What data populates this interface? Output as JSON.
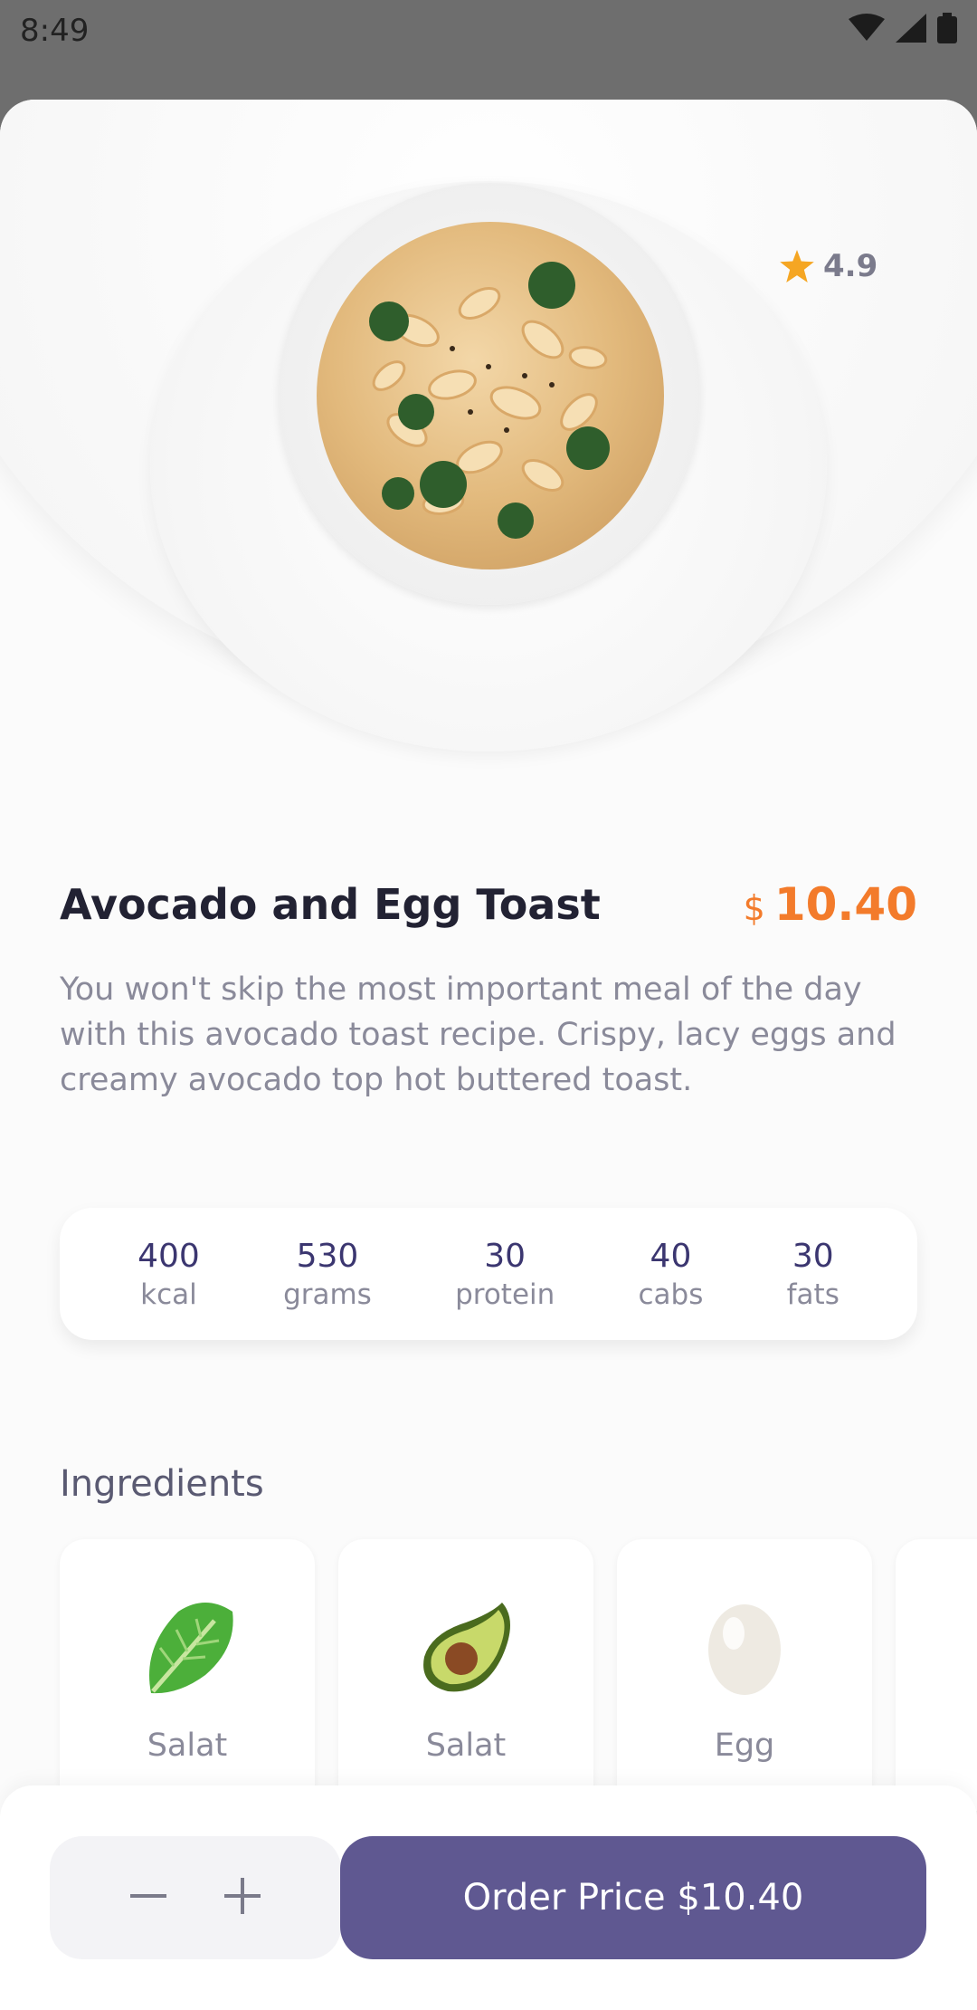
{
  "status_bar": {
    "time": "8:49"
  },
  "dish": {
    "rating": "4.9",
    "title": "Avocado and Egg Toast",
    "price_currency": "$",
    "price_amount": "10.40",
    "description": "You won't skip the most important meal of the day with this avocado toast recipe. Crispy, lacy eggs and creamy avocado top hot buttered toast."
  },
  "nutrition": [
    {
      "value": "400",
      "label": "kcal"
    },
    {
      "value": "530",
      "label": "grams"
    },
    {
      "value": "30",
      "label": "protein"
    },
    {
      "value": "40",
      "label": "cabs"
    },
    {
      "value": "30",
      "label": "fats"
    }
  ],
  "ingredients_section": {
    "title": "Ingredients",
    "items": [
      {
        "label": "Salat",
        "icon": "lettuce-icon"
      },
      {
        "label": "Salat",
        "icon": "avocado-icon"
      },
      {
        "label": "Egg",
        "icon": "egg-icon"
      }
    ]
  },
  "order": {
    "button_label": "Order Price $10.40",
    "decrement_icon": "minus-icon",
    "increment_icon": "plus-icon"
  },
  "colors": {
    "accent": "#5f5891",
    "price": "#f37b2b",
    "star": "#f5a623"
  }
}
